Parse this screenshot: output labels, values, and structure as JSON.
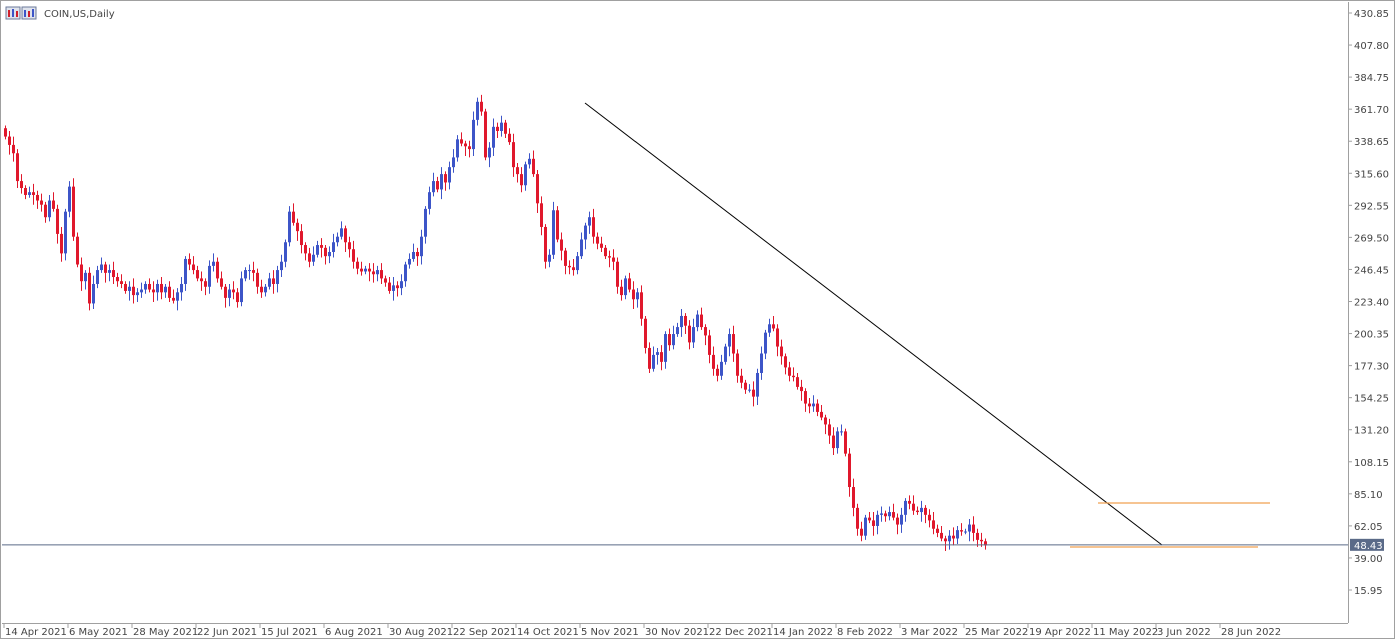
{
  "window": {
    "title": "COIN,US,Daily",
    "icon": "candlestick-window-icon"
  },
  "colors": {
    "bull": "#3d55c8",
    "bear": "#e0182c",
    "trendline": "#000000",
    "range_lines": "#f0a050",
    "current_price_line": "#5a6a88",
    "price_tag_bg": "#5a6a88",
    "axis": "#a0a0a0"
  },
  "chart_data": {
    "type": "candlestick",
    "symbol": "COIN,US",
    "timeframe": "Daily",
    "y_axis": {
      "labels": [
        "430.85",
        "407.80",
        "384.75",
        "361.70",
        "338.65",
        "315.60",
        "292.55",
        "269.50",
        "246.45",
        "223.40",
        "200.35",
        "177.30",
        "154.25",
        "131.20",
        "108.15",
        "85.10",
        "62.05",
        "39.00",
        "15.95"
      ],
      "range": [
        8,
        436
      ]
    },
    "x_axis": {
      "labels": [
        "14 Apr 2021",
        "6 May 2021",
        "28 May 2021",
        "22 Jun 2021",
        "15 Jul 2021",
        "6 Aug 2021",
        "30 Aug 2021",
        "22 Sep 2021",
        "14 Oct 2021",
        "5 Nov 2021",
        "30 Nov 2021",
        "22 Dec 2021",
        "14 Jan 2022",
        "8 Feb 2022",
        "3 Mar 2022",
        "25 Mar 2022",
        "19 Apr 2022",
        "11 May 2022",
        "3 Jun 2022",
        "28 Jun 2022"
      ],
      "bars_per_label": 16
    },
    "current_price": 48.43,
    "closes": [
      342,
      336,
      330,
      310,
      305,
      300,
      302,
      300,
      296,
      293,
      284,
      296,
      290,
      272,
      258,
      288,
      306,
      270,
      250,
      238,
      244,
      222,
      236,
      246,
      250,
      244,
      246,
      241,
      238,
      236,
      231,
      234,
      228,
      230,
      232,
      236,
      232,
      230,
      236,
      230,
      234,
      226,
      224,
      230,
      236,
      254,
      250,
      246,
      240,
      238,
      234,
      249,
      252,
      240,
      234,
      226,
      232,
      230,
      223,
      240,
      246,
      246,
      244,
      234,
      230,
      234,
      240,
      236,
      246,
      252,
      266,
      288,
      280,
      274,
      264,
      258,
      252,
      257,
      264,
      262,
      256,
      259,
      266,
      270,
      276,
      266,
      261,
      252,
      247,
      245,
      247,
      245,
      243,
      246,
      240,
      237,
      231,
      235,
      233,
      238,
      250,
      254,
      259,
      256,
      270,
      290,
      302,
      310,
      304,
      315,
      309,
      320,
      327,
      340,
      337,
      335,
      333,
      354,
      367,
      360,
      327,
      334,
      349,
      346,
      352,
      344,
      338,
      320,
      315,
      307,
      322,
      326,
      315,
      294,
      277,
      252,
      257,
      289,
      268,
      260,
      249,
      248,
      246,
      256,
      268,
      278,
      284,
      270,
      265,
      262,
      256,
      255,
      252,
      234,
      228,
      240,
      232,
      225,
      230,
      211,
      190,
      175,
      185,
      187,
      180,
      200,
      192,
      200,
      205,
      213,
      206,
      194,
      205,
      214,
      205,
      199,
      185,
      175,
      170,
      180,
      191,
      200,
      186,
      170,
      165,
      160,
      160,
      155,
      172,
      186,
      201,
      207,
      204,
      191,
      184,
      176,
      170,
      169,
      162,
      159,
      150,
      148,
      150,
      144,
      140,
      135,
      127,
      118,
      130,
      130,
      114,
      90,
      75,
      60,
      55,
      68,
      66,
      62,
      70,
      71,
      69,
      72,
      68,
      63,
      70,
      80,
      78,
      73,
      72,
      75,
      70,
      66,
      60,
      57,
      53,
      51,
      55,
      53,
      59,
      58,
      58,
      63,
      57,
      52,
      51,
      48
    ]
  }
}
